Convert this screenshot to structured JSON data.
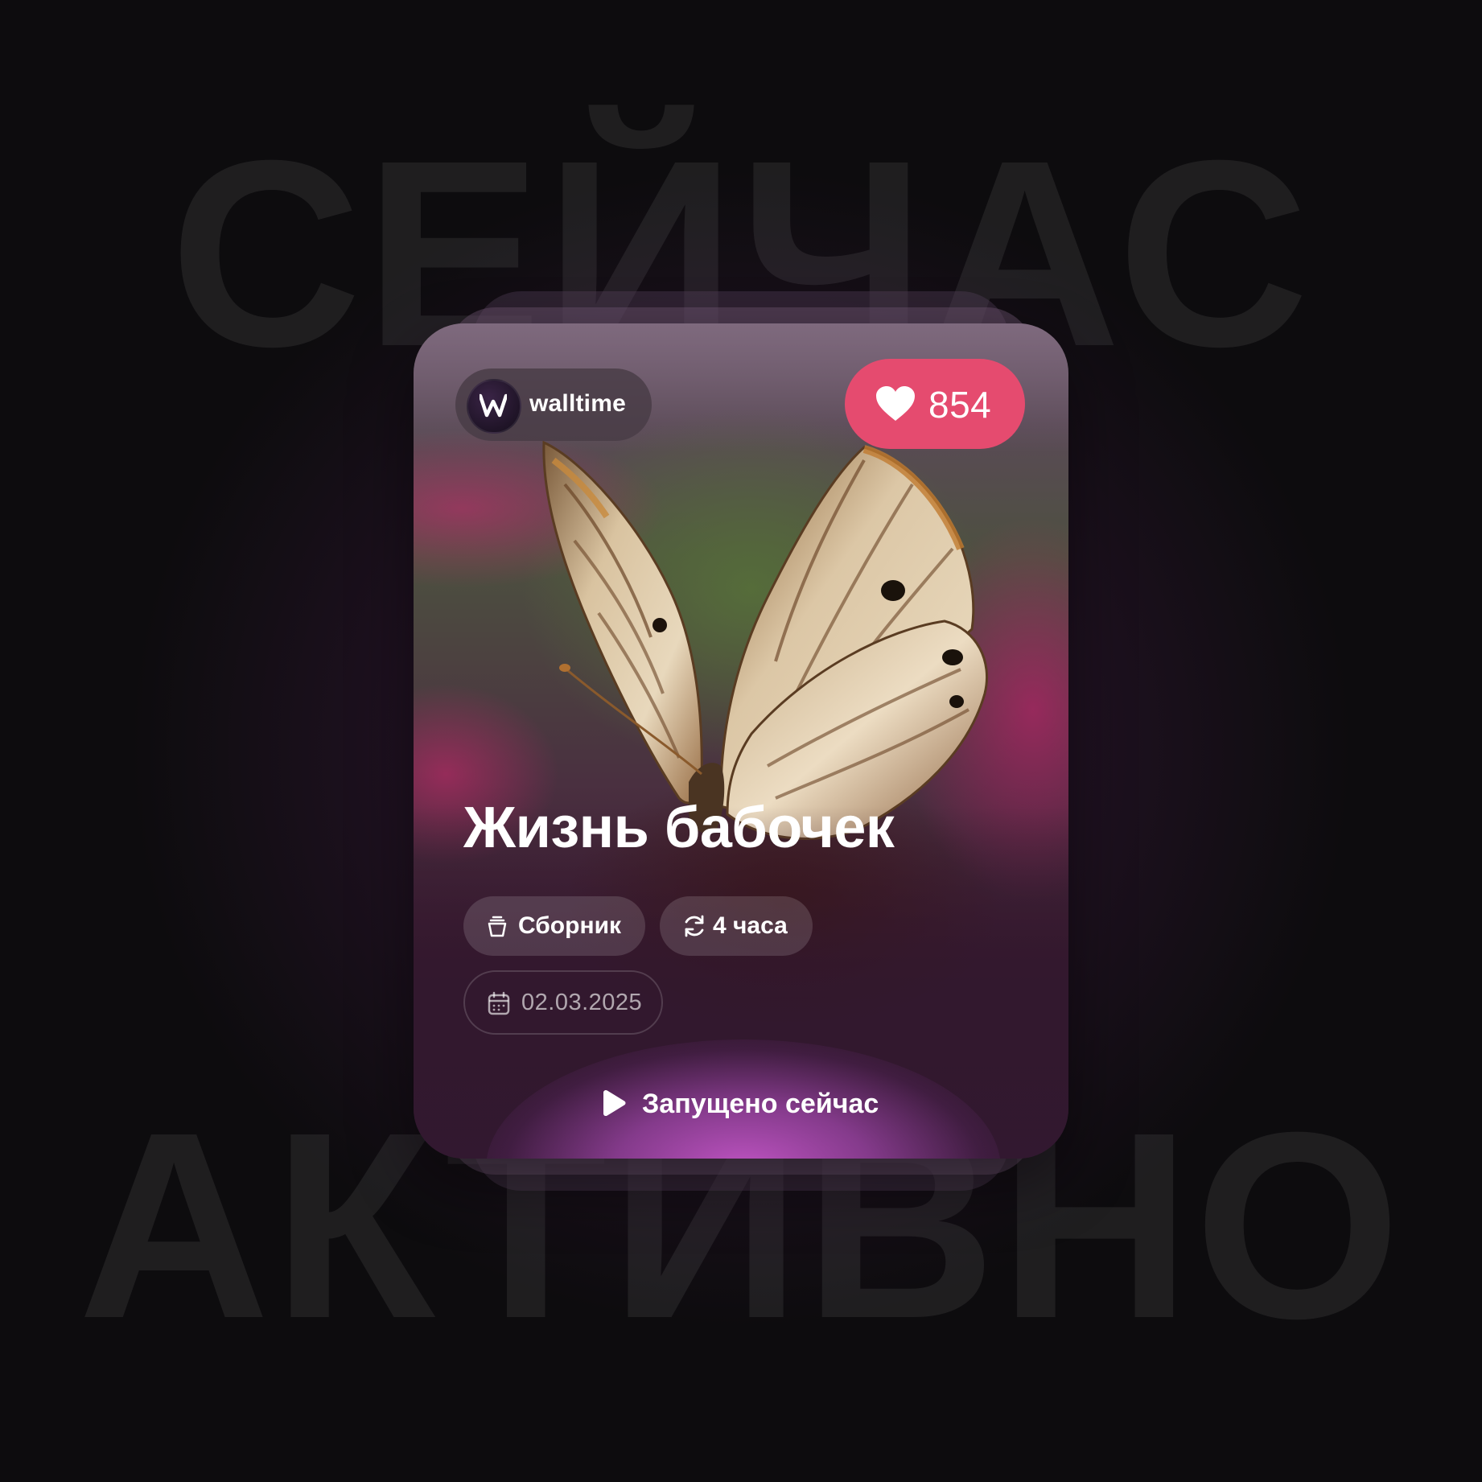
{
  "background": {
    "word_top": "СЕЙЧАС",
    "word_bottom": "АКТИВНО"
  },
  "card": {
    "brand": {
      "name": "walltime",
      "logo_icon": "walltime-logo-icon"
    },
    "likes": {
      "icon": "heart-icon",
      "count": "854",
      "color": "#e54b6f"
    },
    "title": "Жизнь бабочек",
    "tags": [
      {
        "icon": "collection-icon",
        "label": "Сборник"
      },
      {
        "icon": "refresh-icon",
        "label": "4 часа"
      }
    ],
    "date": {
      "icon": "calendar-icon",
      "value": "02.03.2025"
    },
    "status": {
      "icon": "play-icon",
      "label": "Запущено сейчас"
    },
    "image": "butterfly-photo"
  }
}
